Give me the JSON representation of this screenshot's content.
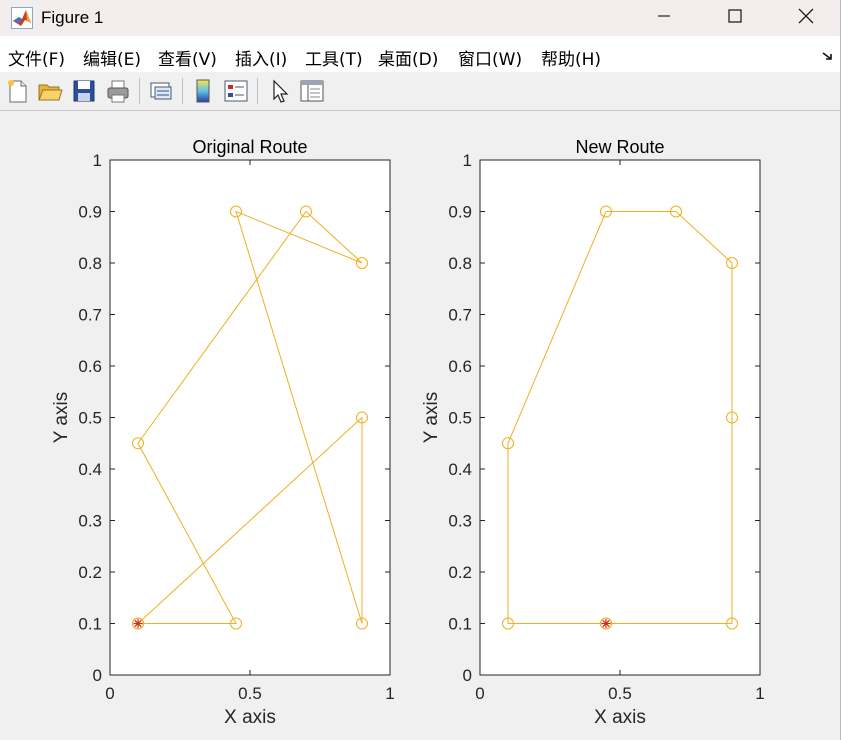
{
  "window": {
    "title": "Figure 1",
    "controls": [
      "minimize",
      "maximize",
      "close"
    ]
  },
  "menu": {
    "items": [
      "文件(F)",
      "编辑(E)",
      "查看(V)",
      "插入(I)",
      "工具(T)",
      "桌面(D)",
      "窗口(W)",
      "帮助(H)"
    ]
  },
  "toolbar": {
    "buttons": [
      "new-figure-icon",
      "open-file-icon",
      "save-icon",
      "print-icon",
      "link-plot-icon",
      "insert-colorbar-icon",
      "insert-legend-icon",
      "edit-plot-arrow-icon",
      "property-inspector-icon"
    ]
  },
  "colors": {
    "route": "#EDB120",
    "start_marker": "#D62728",
    "axes": "#262626"
  },
  "chart_data": [
    {
      "type": "line",
      "title": "Original Route",
      "xlabel": "X axis",
      "ylabel": "Y axis",
      "xlim": [
        0,
        1
      ],
      "ylim": [
        0,
        1
      ],
      "xticks": [
        "0",
        "0.5",
        "1"
      ],
      "yticks": [
        "0",
        "0.1",
        "0.2",
        "0.3",
        "0.4",
        "0.5",
        "0.6",
        "0.7",
        "0.8",
        "0.9",
        "1"
      ],
      "x": [
        0.1,
        0.45,
        0.1,
        0.7,
        0.9,
        0.45,
        0.9,
        0.9,
        0.1
      ],
      "y": [
        0.1,
        0.1,
        0.45,
        0.9,
        0.8,
        0.9,
        0.1,
        0.5,
        0.1
      ],
      "start": {
        "x": 0.1,
        "y": 0.1
      }
    },
    {
      "type": "line",
      "title": "New Route",
      "xlabel": "X axis",
      "ylabel": "Y axis",
      "xlim": [
        0,
        1
      ],
      "ylim": [
        0,
        1
      ],
      "xticks": [
        "0",
        "0.5",
        "1"
      ],
      "yticks": [
        "0",
        "0.1",
        "0.2",
        "0.3",
        "0.4",
        "0.5",
        "0.6",
        "0.7",
        "0.8",
        "0.9",
        "1"
      ],
      "x": [
        0.45,
        0.1,
        0.1,
        0.45,
        0.7,
        0.9,
        0.9,
        0.9,
        0.45
      ],
      "y": [
        0.1,
        0.1,
        0.45,
        0.9,
        0.9,
        0.8,
        0.5,
        0.1,
        0.1
      ],
      "start": {
        "x": 0.45,
        "y": 0.1
      }
    }
  ]
}
